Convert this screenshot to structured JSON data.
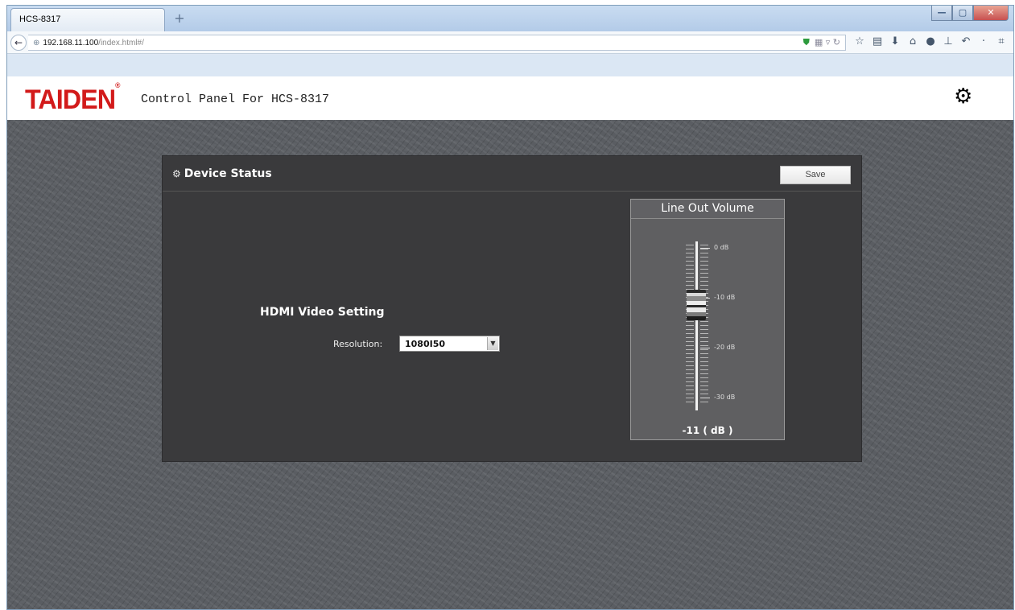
{
  "browser": {
    "tab_title": "HCS-8317",
    "new_tab_icon": "+",
    "back_icon": "←",
    "url_host": "192.168.11.100",
    "url_path": "/index.html#/",
    "window_controls": {
      "minimize": "—",
      "maximize": "▢",
      "close": "✕"
    }
  },
  "header": {
    "logo_text": "TAIDEN",
    "logo_mark": "®",
    "title": "Control Panel For HCS-8317",
    "settings_icon": "gear-icon"
  },
  "panel": {
    "title": "Device Status",
    "save_label": "Save"
  },
  "hdmi": {
    "section_title": "HDMI Video Setting",
    "resolution_label": "Resolution:",
    "resolution_value": "1080I50"
  },
  "volume": {
    "title": "Line Out Volume",
    "scale_labels": [
      "0 dB",
      "-10 dB",
      "-20 dB",
      "-30 dB"
    ],
    "value_display": "-11 ( dB )",
    "value_db": -11,
    "range_db": [
      -30,
      0
    ]
  },
  "colors": {
    "brand_red": "#d21a1a",
    "panel_bg": "#3a3a3c",
    "stage_bg": "#5a5d62"
  }
}
